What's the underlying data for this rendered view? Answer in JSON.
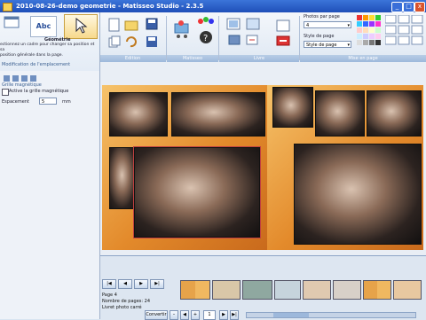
{
  "window": {
    "title": "2010-08-26-demo geometrie - Matisseo Studio - 2.3.5"
  },
  "ribbon": {
    "groups": [
      {
        "label": "Edition"
      },
      {
        "label": "Matisseo"
      },
      {
        "label": "Livre"
      },
      {
        "label": "Mise en page"
      }
    ],
    "photos_per_page_label": "Photos par page",
    "photos_per_page_value": "4",
    "page_style_label": "Style de page",
    "page_style_value": "Style de page"
  },
  "left_panel": {
    "tab_text": "Abc",
    "geometry_title": "Géométrie",
    "geometry_desc": "ectionnez un cadre pour changer sa position et sa\nposition générale dans la page.",
    "modify_location": "Modification de l'emplacement",
    "magnetic_grid": "Grille magnétique",
    "activate_grid": "Active la grille magnétique",
    "spacing_label": "Espacement",
    "spacing_value": "5",
    "spacing_unit": "mm"
  },
  "filmstrip": {
    "page_label": "Page 4",
    "page_count": "Nombre de pages: 24",
    "book_type": "Livret photo carré",
    "convert_label": "Convertir",
    "page_field": "1"
  }
}
